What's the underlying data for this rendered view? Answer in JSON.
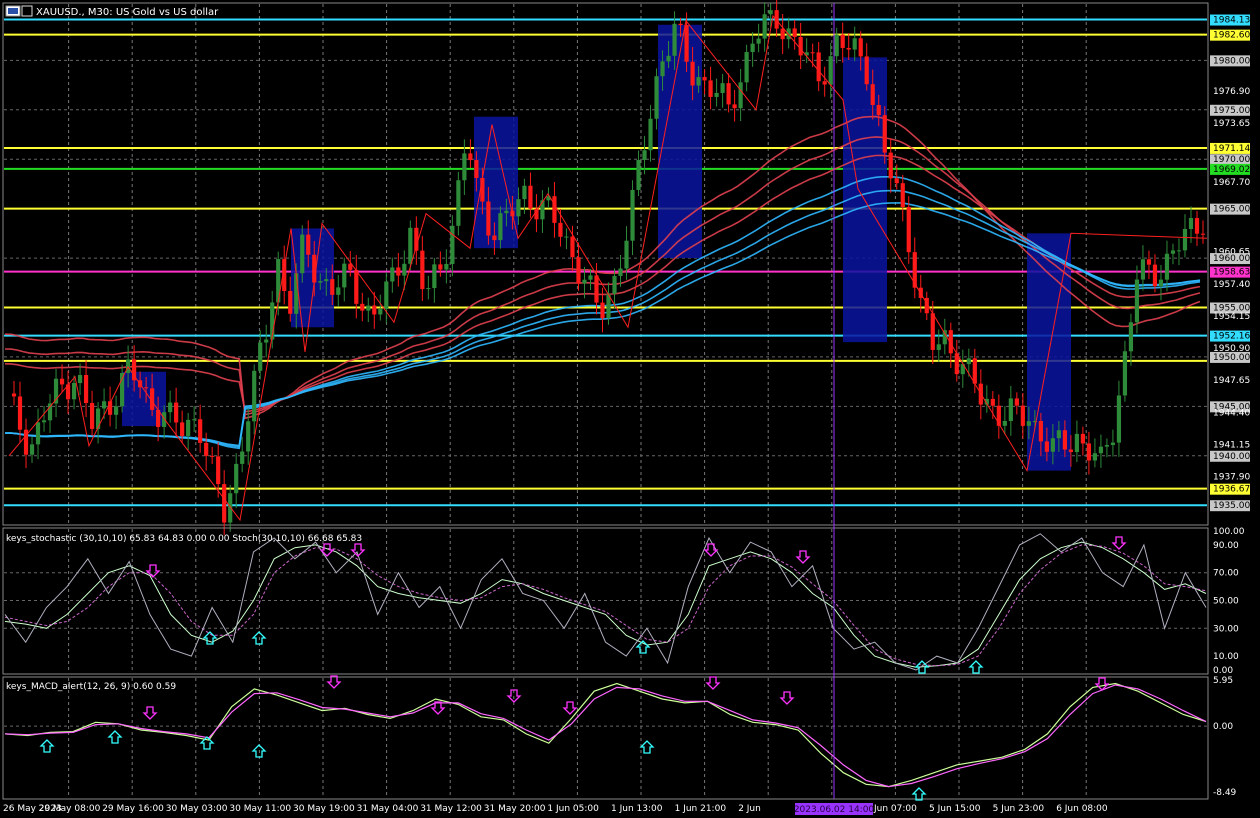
{
  "window": {
    "title": "XAUUSD., M30:  US Gold vs US dollar",
    "stoch_title": "keys_stochastic (30,10,10) 65.83 64.83 0.00 0.00 Stoch(30,10,10) 66.68 65.83",
    "macd_title": "keys_MACD_alert(12, 26, 9) 0.60 0.59",
    "cursor_time": "2023.06.02 14:00"
  },
  "colors": {
    "background": "#000000",
    "bull": "#2e8b3a",
    "bear": "#ff1a1a",
    "ma_red": "#e0404f",
    "ma_blue": "#2fb8ff",
    "zigzag": "#ff2020",
    "box": "#0a14a0",
    "yellow_line": "#ffff33",
    "cyan_line": "#33ddff",
    "green_line": "#22dd22",
    "magenta_line": "#ff33cc",
    "cursor": "#9933ff",
    "stoch_main": "#ccffcc",
    "stoch_signal": "#cc66cc",
    "stoch_raw": "#b0b0c0",
    "macd_main": "#ccff99",
    "macd_signal": "#ff66ff",
    "arrow_up": "#33ffff",
    "arrow_down": "#ff33ff"
  },
  "chart_data": [
    {
      "type": "candlestick",
      "symbol": "XAUUSD.",
      "timeframe": "M30",
      "ylim": [
        1933.3,
        1985.6
      ],
      "y_ticks": [
        {
          "label": "1984.13",
          "v": 1984.13,
          "style": "cyan"
        },
        {
          "label": "1982.60",
          "v": 1982.6,
          "style": "yellow"
        },
        {
          "label": "1980.00",
          "v": 1980.0,
          "style": "gray"
        },
        {
          "label": "1976.90",
          "v": 1976.9,
          "style": "plain"
        },
        {
          "label": "1975.00",
          "v": 1975.0,
          "style": "gray"
        },
        {
          "label": "1973.65",
          "v": 1973.65,
          "style": "plain"
        },
        {
          "label": "1971.14",
          "v": 1971.14,
          "style": "yellow"
        },
        {
          "label": "1970.00",
          "v": 1970.0,
          "style": "gray"
        },
        {
          "label": "1969.02",
          "v": 1969.02,
          "style": "green"
        },
        {
          "label": "1967.70",
          "v": 1967.7,
          "style": "plain"
        },
        {
          "label": "1965.00",
          "v": 1965.0,
          "style": "gray"
        },
        {
          "label": "1960.65",
          "v": 1960.65,
          "style": "plain"
        },
        {
          "label": "1960.00",
          "v": 1960.0,
          "style": "gray"
        },
        {
          "label": "1958.63",
          "v": 1958.63,
          "style": "magenta"
        },
        {
          "label": "1957.40",
          "v": 1957.4,
          "style": "plain"
        },
        {
          "label": "1955.00",
          "v": 1955.0,
          "style": "gray"
        },
        {
          "label": "1954.15",
          "v": 1954.15,
          "style": "plain"
        },
        {
          "label": "1952.16",
          "v": 1952.16,
          "style": "cyan"
        },
        {
          "label": "1950.90",
          "v": 1950.9,
          "style": "plain"
        },
        {
          "label": "1950.00",
          "v": 1950.0,
          "style": "gray"
        },
        {
          "label": "1947.65",
          "v": 1947.65,
          "style": "plain"
        },
        {
          "label": "1945.00",
          "v": 1945.0,
          "style": "gray"
        },
        {
          "label": "1944.40",
          "v": 1944.4,
          "style": "plain"
        },
        {
          "label": "1941.15",
          "v": 1941.15,
          "style": "plain"
        },
        {
          "label": "1940.00",
          "v": 1940.0,
          "style": "gray"
        },
        {
          "label": "1937.90",
          "v": 1937.9,
          "style": "plain"
        },
        {
          "label": "1936.67",
          "v": 1936.67,
          "style": "yellow"
        },
        {
          "label": "1935.00",
          "v": 1935.0,
          "style": "gray"
        }
      ],
      "h_lines": [
        {
          "v": 1984.13,
          "color": "cyan"
        },
        {
          "v": 1982.6,
          "color": "yellow"
        },
        {
          "v": 1971.14,
          "color": "yellow"
        },
        {
          "v": 1969.02,
          "color": "green"
        },
        {
          "v": 1965.0,
          "color": "yellow"
        },
        {
          "v": 1958.63,
          "color": "magenta"
        },
        {
          "v": 1955.0,
          "color": "yellow"
        },
        {
          "v": 1952.16,
          "color": "cyan"
        },
        {
          "v": 1949.6,
          "color": "yellow"
        },
        {
          "v": 1936.67,
          "color": "yellow"
        },
        {
          "v": 1935.0,
          "color": "cyan"
        }
      ],
      "x_labels": [
        "26 May 2023",
        "29 May 08:00",
        "29 May 16:00",
        "30 May 03:00",
        "30 May 11:00",
        "30 May 19:00",
        "31 May 04:00",
        "31 May 12:00",
        "31 May 20:00",
        "1 Jun 05:00",
        "1 Jun 13:00",
        "1 Jun 21:00",
        "2 Jun",
        "2 Jun 22:00",
        "5 Jun 07:00",
        "5 Jun 15:00",
        "5 Jun 23:00",
        "6 Jun 08:00"
      ],
      "bars": 200,
      "price_path": [
        [
          0,
          1945.5
        ],
        [
          6,
          1941
        ],
        [
          12,
          1946
        ],
        [
          18,
          1948.5
        ],
        [
          22,
          1943
        ],
        [
          26,
          1945
        ],
        [
          32,
          1948.8
        ],
        [
          36,
          1946
        ],
        [
          42,
          1944
        ],
        [
          46,
          1942.5
        ],
        [
          50,
          1944
        ],
        [
          54,
          1938
        ],
        [
          57,
          1934
        ],
        [
          61,
          1940
        ],
        [
          64,
          1946
        ],
        [
          68,
          1952
        ],
        [
          71,
          1960
        ],
        [
          74,
          1955
        ],
        [
          78,
          1961
        ],
        [
          82,
          1958
        ],
        [
          86,
          1957
        ],
        [
          90,
          1958
        ],
        [
          96,
          1954
        ],
        [
          102,
          1958
        ],
        [
          106,
          1963
        ],
        [
          110,
          1956
        ],
        [
          114,
          1959
        ],
        [
          118,
          1965
        ],
        [
          121,
          1972
        ],
        [
          124,
          1966
        ],
        [
          128,
          1963
        ],
        [
          132,
          1964
        ],
        [
          136,
          1966.5
        ],
        [
          142,
          1965
        ],
        [
          148,
          1961
        ],
        [
          152,
          1958
        ],
        [
          156,
          1954
        ],
        [
          160,
          1958
        ],
        [
          164,
          1964
        ],
        [
          168,
          1972
        ],
        [
          172,
          1980
        ],
        [
          176,
          1983
        ],
        [
          180,
          1979
        ],
        [
          186,
          1977
        ],
        [
          190,
          1975
        ]
      ],
      "price_path2": [
        [
          120,
          1975
        ],
        [
          124,
          1982
        ],
        [
          128,
          1984.5
        ],
        [
          132,
          1981
        ],
        [
          135,
          1978.5
        ],
        [
          138,
          1981.5
        ],
        [
          141,
          1981
        ],
        [
          143,
          1979.5
        ],
        [
          146,
          1970
        ],
        [
          148,
          1967
        ],
        [
          150,
          1962
        ],
        [
          152,
          1955
        ],
        [
          154,
          1951
        ],
        [
          156,
          1952
        ],
        [
          158,
          1950
        ],
        [
          162,
          1946
        ],
        [
          166,
          1944
        ],
        [
          170,
          1944
        ],
        [
          174,
          1940.5
        ],
        [
          178,
          1942
        ],
        [
          182,
          1939
        ],
        [
          184,
          1943
        ],
        [
          186,
          1950
        ],
        [
          188,
          1958
        ],
        [
          192,
          1959
        ],
        [
          196,
          1962
        ],
        [
          200,
          1965
        ]
      ],
      "boxes": [
        {
          "from": 1948.5,
          "to": 1943
        },
        {
          "from": 1963,
          "to": 1953
        },
        {
          "from": 1974.3,
          "to": 1961
        },
        {
          "from": 1983.6,
          "to": 1960
        },
        {
          "from": 1980.3,
          "to": 1951.5
        },
        {
          "from": 1962.5,
          "to": 1938.5
        }
      ]
    },
    {
      "type": "line",
      "name": "keys_stochastic",
      "ylim": [
        0,
        100
      ],
      "y_ticks": [
        "100.00",
        "90.00",
        "70.00",
        "50.00",
        "30.00",
        "10.00",
        "0.00"
      ],
      "series": [
        {
          "name": "Stoch",
          "values": [
            35,
            33,
            30,
            40,
            55,
            70,
            75,
            68,
            40,
            25,
            20,
            28,
            50,
            80,
            88,
            90,
            85,
            75,
            60,
            55,
            52,
            50,
            48,
            55,
            65,
            62,
            55,
            50,
            45,
            40,
            25,
            18,
            20,
            40,
            75,
            80,
            85,
            80,
            70,
            55,
            45,
            25,
            10,
            5,
            2,
            3,
            5,
            15,
            40,
            65,
            80,
            88,
            92,
            88,
            80,
            70,
            58,
            62,
            55
          ]
        },
        {
          "name": "Signal",
          "values": [
            38,
            35,
            32,
            35,
            45,
            60,
            70,
            70,
            55,
            35,
            25,
            25,
            40,
            70,
            82,
            88,
            87,
            80,
            68,
            60,
            55,
            52,
            50,
            52,
            60,
            62,
            58,
            52,
            47,
            42,
            32,
            22,
            20,
            30,
            60,
            75,
            82,
            82,
            74,
            62,
            50,
            32,
            15,
            8,
            4,
            3,
            4,
            10,
            30,
            55,
            72,
            84,
            90,
            89,
            84,
            75,
            62,
            60,
            57
          ]
        },
        {
          "name": "Raw",
          "values": [
            40,
            20,
            45,
            60,
            80,
            55,
            78,
            40,
            15,
            10,
            45,
            20,
            85,
            95,
            80,
            92,
            70,
            85,
            40,
            70,
            45,
            60,
            30,
            65,
            80,
            55,
            50,
            30,
            55,
            20,
            10,
            30,
            5,
            60,
            95,
            70,
            92,
            85,
            60,
            75,
            30,
            15,
            20,
            5,
            0,
            10,
            5,
            30,
            60,
            90,
            98,
            85,
            95,
            70,
            60,
            90,
            30,
            70,
            45
          ]
        }
      ],
      "arrows_up": 6,
      "arrows_down": 6
    },
    {
      "type": "line",
      "name": "keys_MACD_alert",
      "ylim": [
        -8.49,
        5.95
      ],
      "y_ticks": [
        "5.95",
        "0.00",
        "-8.49"
      ],
      "series": [
        {
          "name": "MACD",
          "values": [
            -1.0,
            -1.2,
            -0.8,
            -0.7,
            0.5,
            0.3,
            -0.5,
            -0.8,
            -1.2,
            -1.8,
            2.5,
            4.8,
            4.0,
            3.0,
            2.0,
            2.3,
            1.5,
            1.0,
            2.0,
            3.5,
            2.8,
            1.2,
            0.8,
            -1.0,
            -2.2,
            1.0,
            4.5,
            5.5,
            4.5,
            3.5,
            3.0,
            3.2,
            1.5,
            0.5,
            0.2,
            -0.5,
            -3.5,
            -6.0,
            -7.5,
            -7.8,
            -7.0,
            -6.0,
            -5.0,
            -4.5,
            -4.0,
            -3.0,
            -1.0,
            2.5,
            5.0,
            5.5,
            4.5,
            3.0,
            1.5,
            0.6
          ]
        },
        {
          "name": "Signal",
          "values": [
            -1.0,
            -1.1,
            -0.9,
            -0.8,
            0.2,
            0.3,
            -0.3,
            -0.7,
            -1.0,
            -1.5,
            1.8,
            4.2,
            4.3,
            3.4,
            2.4,
            2.2,
            1.7,
            1.2,
            1.7,
            3.0,
            3.0,
            1.6,
            1.0,
            -0.5,
            -1.8,
            0.3,
            3.5,
            5.0,
            4.8,
            3.9,
            3.2,
            3.2,
            2.0,
            0.8,
            0.4,
            -0.2,
            -2.5,
            -5.0,
            -7.0,
            -7.8,
            -7.4,
            -6.5,
            -5.5,
            -4.8,
            -4.2,
            -3.3,
            -1.6,
            1.5,
            4.2,
            5.3,
            4.8,
            3.5,
            2.0,
            0.59
          ]
        }
      ],
      "arrows_up": 6,
      "arrows_down": 9
    }
  ]
}
